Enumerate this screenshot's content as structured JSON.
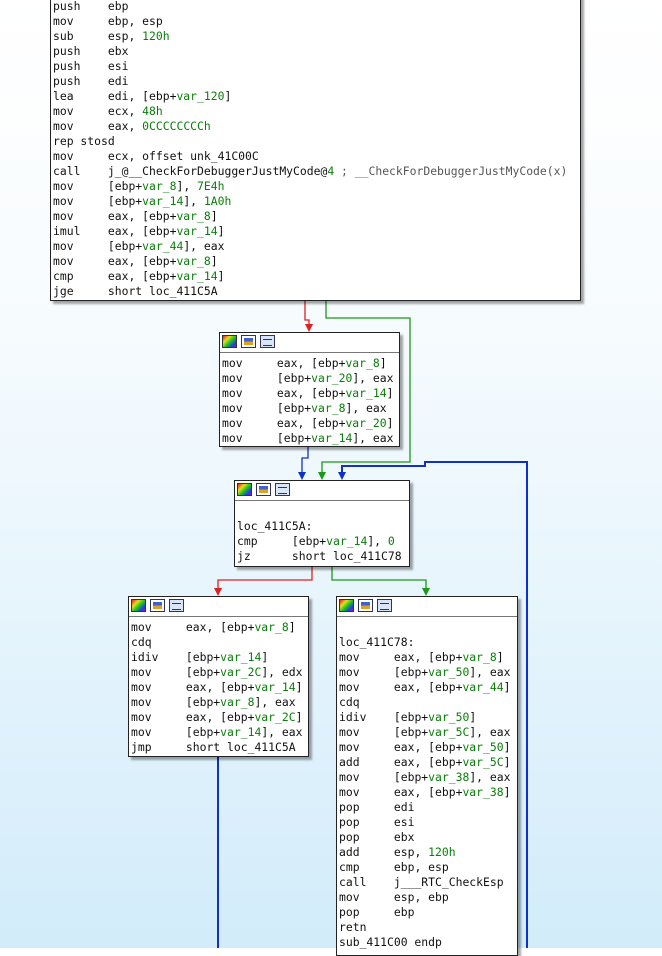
{
  "blocks": {
    "top": {
      "lines": [
        {
          "m": "push",
          "o": "ebp"
        },
        {
          "m": "mov",
          "o": "ebp, esp"
        },
        {
          "m": "sub",
          "o": "esp, 120h"
        },
        {
          "m": "push",
          "o": "ebx"
        },
        {
          "m": "push",
          "o": "esi"
        },
        {
          "m": "push",
          "o": "edi"
        },
        {
          "m": "lea",
          "o": "edi, [ebp+var_120]"
        },
        {
          "m": "mov",
          "o": "ecx, 48h"
        },
        {
          "m": "mov",
          "o": "eax, 0CCCCCCCCh"
        },
        {
          "m": "rep stosd",
          "o": ""
        },
        {
          "m": "mov",
          "o": "ecx, offset unk_41C00C"
        },
        {
          "m": "call",
          "o": "j_@__CheckForDebuggerJustMyCode@4 ; __CheckForDebuggerJustMyCode(x)"
        },
        {
          "m": "mov",
          "o": "[ebp+var_8], 7E4h"
        },
        {
          "m": "mov",
          "o": "[ebp+var_14], 1A0h"
        },
        {
          "m": "mov",
          "o": "eax, [ebp+var_8]"
        },
        {
          "m": "imul",
          "o": "eax, [ebp+var_14]"
        },
        {
          "m": "mov",
          "o": "[ebp+var_44], eax"
        },
        {
          "m": "mov",
          "o": "eax, [ebp+var_8]"
        },
        {
          "m": "cmp",
          "o": "eax, [ebp+var_14]"
        },
        {
          "m": "jge",
          "o": "short loc_411C5A"
        }
      ]
    },
    "swap": {
      "lines": [
        {
          "m": "mov",
          "o": "eax, [ebp+var_8]"
        },
        {
          "m": "mov",
          "o": "[ebp+var_20], eax"
        },
        {
          "m": "mov",
          "o": "eax, [ebp+var_14]"
        },
        {
          "m": "mov",
          "o": "[ebp+var_8], eax"
        },
        {
          "m": "mov",
          "o": "eax, [ebp+var_20]"
        },
        {
          "m": "mov",
          "o": "[ebp+var_14], eax"
        }
      ]
    },
    "loop": {
      "lines": [
        {
          "m": "",
          "o": ""
        },
        {
          "m": "loc_411C5A:",
          "o": ""
        },
        {
          "m": "cmp",
          "o": "[ebp+var_14], 0"
        },
        {
          "m": "jz",
          "o": "short loc_411C78"
        }
      ]
    },
    "body": {
      "lines": [
        {
          "m": "mov",
          "o": "eax, [ebp+var_8]"
        },
        {
          "m": "cdq",
          "o": ""
        },
        {
          "m": "idiv",
          "o": "[ebp+var_14]"
        },
        {
          "m": "mov",
          "o": "[ebp+var_2C], edx"
        },
        {
          "m": "mov",
          "o": "eax, [ebp+var_14]"
        },
        {
          "m": "mov",
          "o": "[ebp+var_8], eax"
        },
        {
          "m": "mov",
          "o": "eax, [ebp+var_2C]"
        },
        {
          "m": "mov",
          "o": "[ebp+var_14], eax"
        },
        {
          "m": "jmp",
          "o": "short loc_411C5A"
        }
      ]
    },
    "exit": {
      "lines": [
        {
          "m": "",
          "o": ""
        },
        {
          "m": "loc_411C78:",
          "o": ""
        },
        {
          "m": "mov",
          "o": "eax, [ebp+var_8]"
        },
        {
          "m": "mov",
          "o": "[ebp+var_50], eax"
        },
        {
          "m": "mov",
          "o": "eax, [ebp+var_44]"
        },
        {
          "m": "cdq",
          "o": ""
        },
        {
          "m": "idiv",
          "o": "[ebp+var_50]"
        },
        {
          "m": "mov",
          "o": "[ebp+var_5C], eax"
        },
        {
          "m": "mov",
          "o": "eax, [ebp+var_50]"
        },
        {
          "m": "add",
          "o": "eax, [ebp+var_5C]"
        },
        {
          "m": "mov",
          "o": "[ebp+var_38], eax"
        },
        {
          "m": "mov",
          "o": "eax, [ebp+var_38]"
        },
        {
          "m": "pop",
          "o": "edi"
        },
        {
          "m": "pop",
          "o": "esi"
        },
        {
          "m": "pop",
          "o": "ebx"
        },
        {
          "m": "add",
          "o": "esp, 120h"
        },
        {
          "m": "cmp",
          "o": "ebp, esp"
        },
        {
          "m": "call",
          "o": "j___RTC_CheckEsp"
        },
        {
          "m": "mov",
          "o": "esp, ebp"
        },
        {
          "m": "pop",
          "o": "ebp"
        },
        {
          "m": "retn",
          "o": ""
        },
        {
          "m": "sub_411C00 endp",
          "o": ""
        }
      ]
    }
  },
  "colors": {
    "edge_true": "#1a9a1a",
    "edge_false": "#e02020",
    "edge_uncond": "#1030c8",
    "operand_highlight": "#0a7d0a"
  },
  "header_icons": [
    "graph-overview-icon",
    "edit-block-color-icon",
    "group-nodes-icon"
  ]
}
